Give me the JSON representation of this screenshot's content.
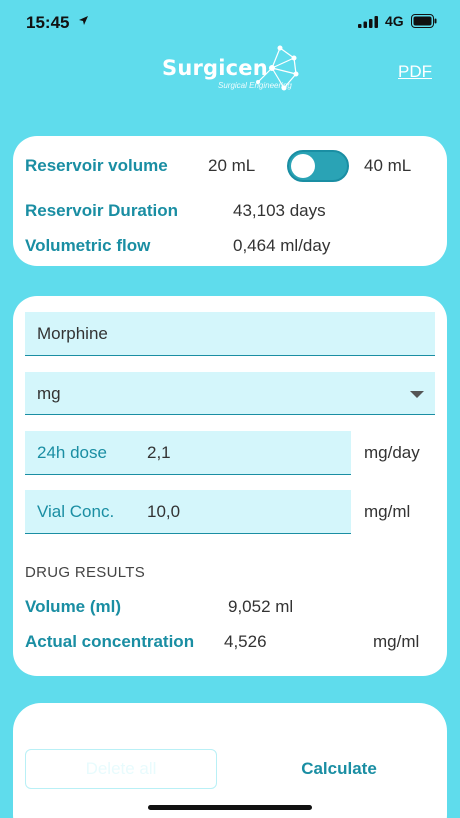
{
  "status_bar": {
    "time": "15:45",
    "network": "4G"
  },
  "header": {
    "logo_text": "Surgicen",
    "logo_subtitle": "Surgical Engineering",
    "pdf_label": "PDF"
  },
  "reservoir": {
    "volume_label": "Reservoir volume",
    "option_left": "20 mL",
    "option_right": "40 mL",
    "toggle_selected": "20 mL",
    "duration_label": "Reservoir Duration",
    "duration_value": "43,103 days",
    "flow_label": "Volumetric flow",
    "flow_value": "0,464 ml/day"
  },
  "drug": {
    "name_value": "Morphine",
    "unit_select_value": "mg",
    "dose_label": "24h dose",
    "dose_value": "2,1",
    "dose_unit": "mg/day",
    "vial_label": "Vial Conc.",
    "vial_value": "10,0",
    "vial_unit": "mg/ml",
    "results_title": "DRUG RESULTS",
    "volume_label": "Volume (ml)",
    "volume_value": "9,052 ml",
    "actual_conc_label": "Actual concentration",
    "actual_conc_value": "4,526",
    "actual_conc_unit": "mg/ml"
  },
  "footer": {
    "delete_label": "Delete all",
    "calculate_label": "Calculate"
  },
  "colors": {
    "background": "#5fdcec",
    "accent": "#1a8ea3",
    "field_bg": "#d4f6fb"
  }
}
